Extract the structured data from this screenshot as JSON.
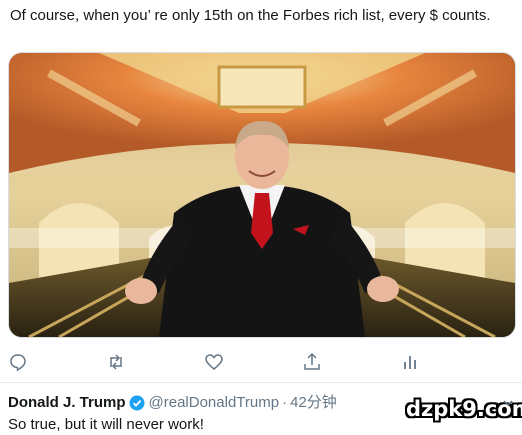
{
  "tweet": {
    "text": "Of course, when you’ re only 15th on the Forbes rich list, every $ counts."
  },
  "media": {
    "icon": "photo-image",
    "colors": {
      "ceiling": "#e07a3a",
      "gold": "#e6c77a",
      "suit": "#151515",
      "tie": "#c2121c"
    }
  },
  "actions": [
    {
      "name": "reply-icon"
    },
    {
      "name": "retweet-icon"
    },
    {
      "name": "like-icon"
    },
    {
      "name": "share-icon"
    },
    {
      "name": "analytics-icon"
    }
  ],
  "reply": {
    "display_name": "Donald J. Trump",
    "handle": "@realDonaldTrump",
    "separator": "·",
    "time": "42分钟",
    "text": "So true, but it will never work!"
  },
  "watermark": "dzpk9.com",
  "accent": "#1da1f2",
  "muted": "#657786"
}
